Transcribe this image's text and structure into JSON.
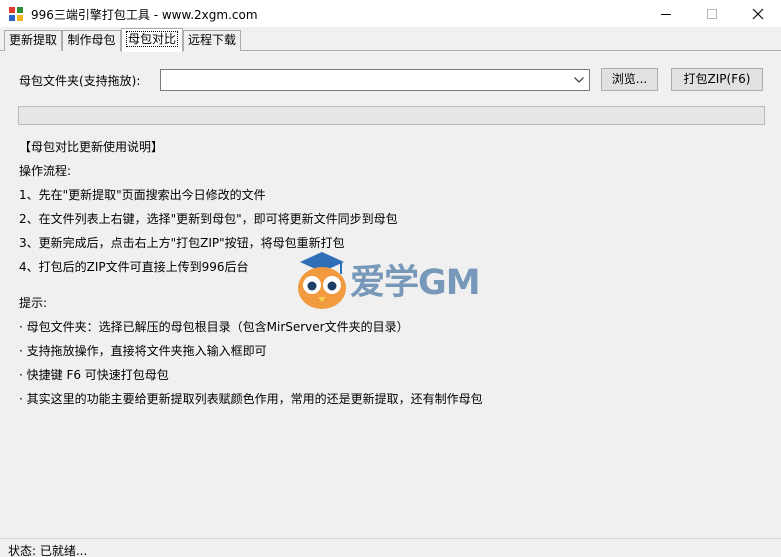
{
  "window": {
    "title": "996三端引擎打包工具 - www.2xgm.com",
    "buttons": {
      "minimize": "minimize-icon",
      "maximize": "maximize-icon",
      "close": "close-icon"
    }
  },
  "tabs": [
    {
      "label": "更新提取",
      "active": false
    },
    {
      "label": "制作母包",
      "active": false
    },
    {
      "label": "母包对比",
      "active": true
    },
    {
      "label": "远程下载",
      "active": false
    }
  ],
  "form": {
    "folder_label": "母包文件夹(支持拖放):",
    "folder_value": "",
    "browse_label": "浏览...",
    "pack_label": "打包ZIP(F6)"
  },
  "progress": {
    "value": 0
  },
  "notes": {
    "heading": "【母包对比更新使用说明】",
    "flow_title": "操作流程:",
    "steps": [
      "1、先在\"更新提取\"页面搜索出今日修改的文件",
      "2、在文件列表上右键，选择\"更新到母包\"，即可将更新文件同步到母包",
      "3、更新完成后，点击右上方\"打包ZIP\"按钮，将母包重新打包",
      "4、打包后的ZIP文件可直接上传到996后台"
    ],
    "tips_title": "提示:",
    "tips": [
      "· 母包文件夹：选择已解压的母包根目录（包含MirServer文件夹的目录）",
      "· 支持拖放操作，直接将文件夹拖入输入框即可",
      "· 快捷键 F6 可快速打包母包",
      "· 其实这里的功能主要给更新提取列表赋颜色作用，常用的还是更新提取，还有制作母包"
    ]
  },
  "watermark": {
    "text": "爱学GM"
  },
  "status": {
    "text": "状态: 已就绪..."
  },
  "colors": {
    "window_bg": "#f0f0f0",
    "accent_blue": "#1e6fcf",
    "watermark": "#6b8fb4"
  }
}
